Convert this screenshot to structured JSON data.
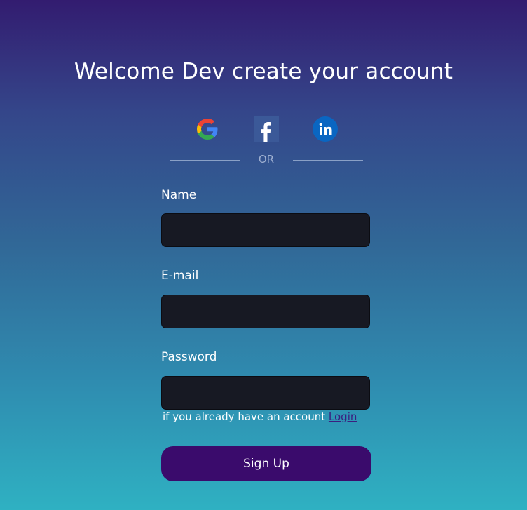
{
  "page": {
    "title": "Welcome Dev create your account"
  },
  "social": [
    {
      "name": "Google",
      "icon": "google-icon"
    },
    {
      "name": "Facebook",
      "icon": "facebook-icon"
    },
    {
      "name": "LinkedIn",
      "icon": "linkedin-icon"
    }
  ],
  "divider": {
    "text": "OR"
  },
  "form": {
    "name_label": "Name",
    "name_value": "",
    "email_label": "E-mail",
    "email_value": "",
    "password_label": "Password",
    "password_value": ""
  },
  "login_prompt": {
    "text": "if you already have an account ",
    "link_label": "Login"
  },
  "signup_button": {
    "label": "Sign Up"
  },
  "colors": {
    "background_top": "#331c70",
    "background_bottom": "#2fb1c2",
    "input_bg": "#171923",
    "button_bg": "#3a0b6c",
    "link": "#3b1f7f"
  }
}
